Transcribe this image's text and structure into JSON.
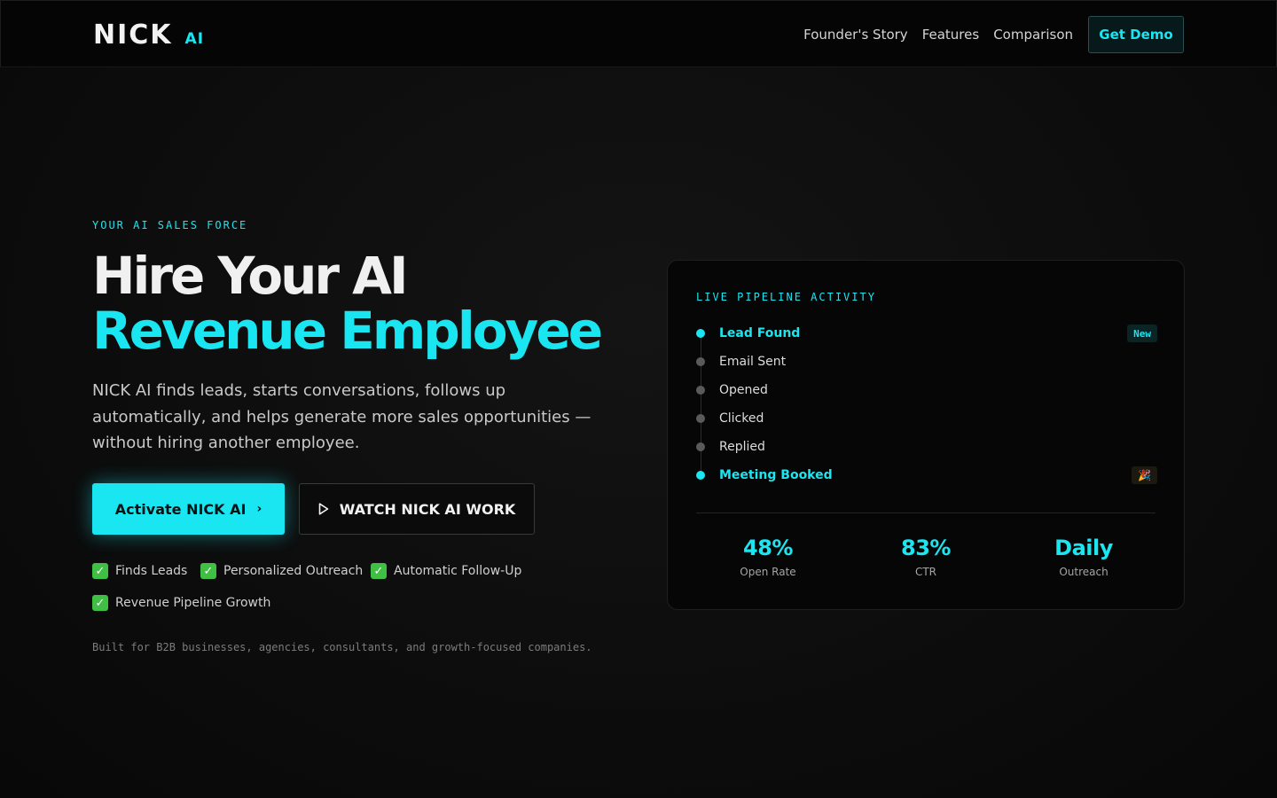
{
  "nav": {
    "logo_main": "NICK",
    "logo_ai": "AI",
    "links": [
      "Founder's Story",
      "Features",
      "Comparison"
    ],
    "cta": "Get Demo"
  },
  "hero": {
    "eyebrow": "YOUR AI SALES FORCE",
    "title_line1": "Hire Your AI",
    "title_line2": "Revenue Employee",
    "lead": "NICK AI finds leads, starts conversations, follows up automatically, and helps generate more sales opportunities — without hiring another employee.",
    "primary_button": "Activate NICK AI",
    "primary_button_icon": "chevron-right-icon",
    "secondary_button": "WATCH NICK AI WORK",
    "secondary_button_icon": "play-icon",
    "features": [
      "Finds Leads",
      "Personalized Outreach",
      "Automatic Follow-Up",
      "Revenue Pipeline Growth"
    ],
    "tagline": "Built for B2B businesses, agencies, consultants, and growth-focused companies."
  },
  "pipeline": {
    "title": "LIVE PIPELINE ACTIVITY",
    "steps": [
      {
        "label": "Lead Found",
        "active": true,
        "badge": "New"
      },
      {
        "label": "Email Sent",
        "active": false,
        "badge": ""
      },
      {
        "label": "Opened",
        "active": false,
        "badge": ""
      },
      {
        "label": "Clicked",
        "active": false,
        "badge": ""
      },
      {
        "label": "Replied",
        "active": false,
        "badge": ""
      },
      {
        "label": "Meeting Booked",
        "active": true,
        "badge": "🎉"
      }
    ],
    "stats": [
      {
        "value": "48%",
        "label": "Open Rate"
      },
      {
        "value": "83%",
        "label": "CTR"
      },
      {
        "value": "Daily",
        "label": "Outreach"
      }
    ]
  },
  "colors": {
    "accent": "#19e6f0",
    "background": "#0b0b0b",
    "check_green": "#3fbf44"
  }
}
